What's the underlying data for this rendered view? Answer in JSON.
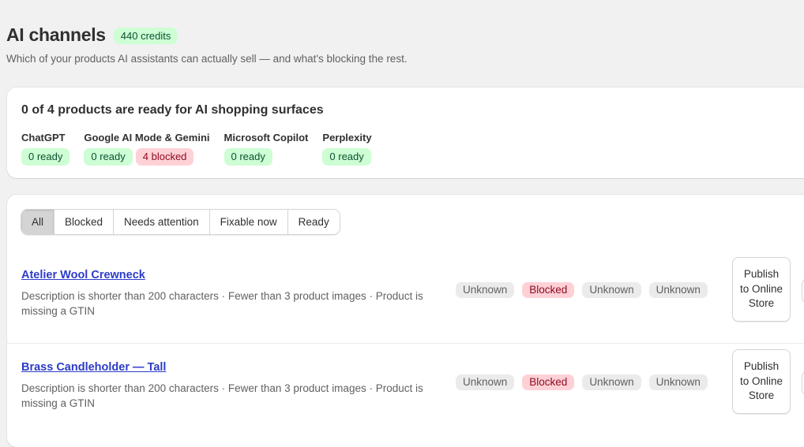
{
  "header": {
    "title": "AI channels",
    "credits": "440 credits",
    "subtitle": "Which of your products AI assistants can actually sell — and what's blocking the rest."
  },
  "summary": {
    "title": "0 of 4 products are ready for AI shopping surfaces",
    "surfaces": [
      {
        "name": "ChatGPT",
        "ready": "0 ready"
      },
      {
        "name": "Google AI Mode & Gemini",
        "ready": "0 ready",
        "blocked": "4 blocked"
      },
      {
        "name": "Microsoft Copilot",
        "ready": "0 ready"
      },
      {
        "name": "Perplexity",
        "ready": "0 ready"
      }
    ]
  },
  "filters": {
    "tabs": [
      "All",
      "Blocked",
      "Needs attention",
      "Fixable now",
      "Ready"
    ],
    "selected": "All"
  },
  "products": [
    {
      "name": "Atelier Wool Crewneck",
      "notes": "Description is shorter than 200 characters · Fewer than 3 product images · Product is missing a GTIN",
      "statuses": [
        "Unknown",
        "Blocked",
        "Unknown",
        "Unknown"
      ],
      "action": "Publish to Online Store"
    },
    {
      "name": "Brass Candleholder — Tall",
      "notes": "Description is shorter than 200 characters · Fewer than 3 product images · Product is missing a GTIN",
      "statuses": [
        "Unknown",
        "Blocked",
        "Unknown",
        "Unknown"
      ],
      "action": "Publish to Online Store"
    }
  ],
  "colors": {
    "ready_bg": "#cdfed4",
    "blocked_bg": "#fed1d7",
    "unknown_bg": "#ebebeb",
    "link": "#2c3cc8"
  }
}
